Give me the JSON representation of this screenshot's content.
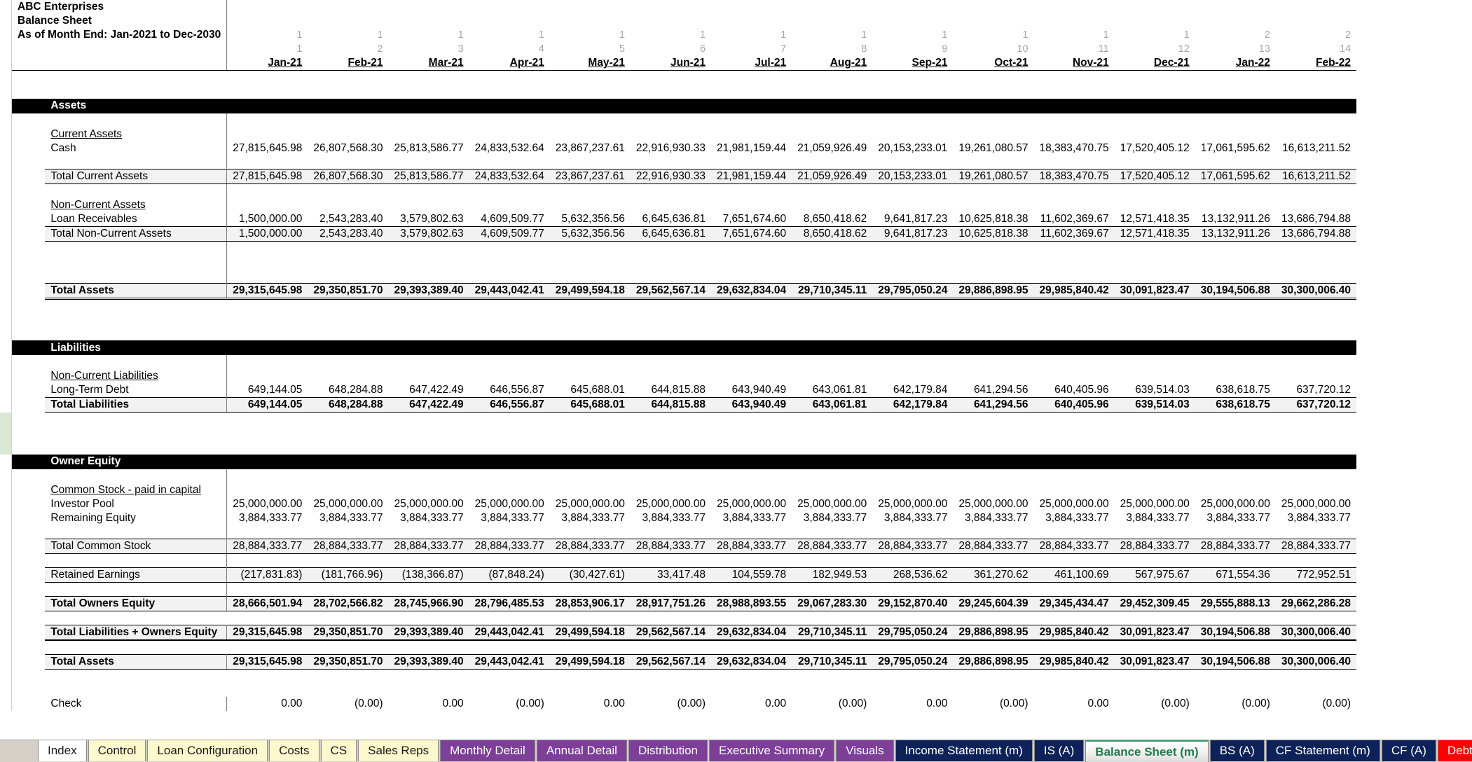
{
  "header": {
    "company": "ABC Enterprises",
    "report": "Balance Sheet",
    "period": "As of Month End: Jan-2021 to Dec-2030"
  },
  "columns": {
    "year_index": [
      "1",
      "1",
      "1",
      "1",
      "1",
      "1",
      "1",
      "1",
      "1",
      "1",
      "1",
      "1",
      "2",
      "2"
    ],
    "month_index": [
      "1",
      "2",
      "3",
      "4",
      "5",
      "6",
      "7",
      "8",
      "9",
      "10",
      "11",
      "12",
      "13",
      "14"
    ],
    "labels": [
      "Jan-21",
      "Feb-21",
      "Mar-21",
      "Apr-21",
      "May-21",
      "Jun-21",
      "Jul-21",
      "Aug-21",
      "Sep-21",
      "Oct-21",
      "Nov-21",
      "Dec-21",
      "Jan-22",
      "Feb-22"
    ]
  },
  "sections": {
    "assets_band": "Assets",
    "liabilities_band": "Liabilities",
    "equity_band": "Owner Equity",
    "current_assets_heading": "Current Assets",
    "non_current_assets_heading": "Non-Current Assets",
    "non_current_liabilities_heading": "Non-Current Liabilities",
    "common_stock_heading": "Common Stock - paid in capital"
  },
  "rows": {
    "cash": {
      "label": "Cash",
      "values": [
        "27,815,645.98",
        "26,807,568.30",
        "25,813,586.77",
        "24,833,532.64",
        "23,867,237.61",
        "22,916,930.33",
        "21,981,159.44",
        "21,059,926.49",
        "20,153,233.01",
        "19,261,080.57",
        "18,383,470.75",
        "17,520,405.12",
        "17,061,595.62",
        "16,613,211.52"
      ]
    },
    "total_current_assets": {
      "label": "Total Current Assets",
      "values": [
        "27,815,645.98",
        "26,807,568.30",
        "25,813,586.77",
        "24,833,532.64",
        "23,867,237.61",
        "22,916,930.33",
        "21,981,159.44",
        "21,059,926.49",
        "20,153,233.01",
        "19,261,080.57",
        "18,383,470.75",
        "17,520,405.12",
        "17,061,595.62",
        "16,613,211.52"
      ]
    },
    "loan_receivables": {
      "label": "Loan Receivables",
      "values": [
        "1,500,000.00",
        "2,543,283.40",
        "3,579,802.63",
        "4,609,509.77",
        "5,632,356.56",
        "6,645,636.81",
        "7,651,674.60",
        "8,650,418.62",
        "9,641,817.23",
        "10,625,818.38",
        "11,602,369.67",
        "12,571,418.35",
        "13,132,911.26",
        "13,686,794.88"
      ]
    },
    "total_non_current_assets": {
      "label": "Total Non-Current Assets",
      "values": [
        "1,500,000.00",
        "2,543,283.40",
        "3,579,802.63",
        "4,609,509.77",
        "5,632,356.56",
        "6,645,636.81",
        "7,651,674.60",
        "8,650,418.62",
        "9,641,817.23",
        "10,625,818.38",
        "11,602,369.67",
        "12,571,418.35",
        "13,132,911.26",
        "13,686,794.88"
      ]
    },
    "total_assets": {
      "label": "Total Assets",
      "values": [
        "29,315,645.98",
        "29,350,851.70",
        "29,393,389.40",
        "29,443,042.41",
        "29,499,594.18",
        "29,562,567.14",
        "29,632,834.04",
        "29,710,345.11",
        "29,795,050.24",
        "29,886,898.95",
        "29,985,840.42",
        "30,091,823.47",
        "30,194,506.88",
        "30,300,006.40"
      ]
    },
    "long_term_debt": {
      "label": "Long-Term Debt",
      "values": [
        "649,144.05",
        "648,284.88",
        "647,422.49",
        "646,556.87",
        "645,688.01",
        "644,815.88",
        "643,940.49",
        "643,061.81",
        "642,179.84",
        "641,294.56",
        "640,405.96",
        "639,514.03",
        "638,618.75",
        "637,720.12"
      ]
    },
    "total_liabilities": {
      "label": "Total Liabilities",
      "values": [
        "649,144.05",
        "648,284.88",
        "647,422.49",
        "646,556.87",
        "645,688.01",
        "644,815.88",
        "643,940.49",
        "643,061.81",
        "642,179.84",
        "641,294.56",
        "640,405.96",
        "639,514.03",
        "638,618.75",
        "637,720.12"
      ]
    },
    "investor_pool": {
      "label": "Investor Pool",
      "values": [
        "25,000,000.00",
        "25,000,000.00",
        "25,000,000.00",
        "25,000,000.00",
        "25,000,000.00",
        "25,000,000.00",
        "25,000,000.00",
        "25,000,000.00",
        "25,000,000.00",
        "25,000,000.00",
        "25,000,000.00",
        "25,000,000.00",
        "25,000,000.00",
        "25,000,000.00"
      ]
    },
    "remaining_equity": {
      "label": "Remaining Equity",
      "values": [
        "3,884,333.77",
        "3,884,333.77",
        "3,884,333.77",
        "3,884,333.77",
        "3,884,333.77",
        "3,884,333.77",
        "3,884,333.77",
        "3,884,333.77",
        "3,884,333.77",
        "3,884,333.77",
        "3,884,333.77",
        "3,884,333.77",
        "3,884,333.77",
        "3,884,333.77"
      ]
    },
    "total_common_stock": {
      "label": "Total Common Stock",
      "values": [
        "28,884,333.77",
        "28,884,333.77",
        "28,884,333.77",
        "28,884,333.77",
        "28,884,333.77",
        "28,884,333.77",
        "28,884,333.77",
        "28,884,333.77",
        "28,884,333.77",
        "28,884,333.77",
        "28,884,333.77",
        "28,884,333.77",
        "28,884,333.77",
        "28,884,333.77"
      ]
    },
    "retained_earnings": {
      "label": "Retained Earnings",
      "values": [
        "(217,831.83)",
        "(181,766.96)",
        "(138,366.87)",
        "(87,848.24)",
        "(30,427.61)",
        "33,417.48",
        "104,559.78",
        "182,949.53",
        "268,536.62",
        "361,270.62",
        "461,100.69",
        "567,975.67",
        "671,554.36",
        "772,952.51"
      ]
    },
    "total_owners_equity": {
      "label": "Total Owners Equity",
      "values": [
        "28,666,501.94",
        "28,702,566.82",
        "28,745,966.90",
        "28,796,485.53",
        "28,853,906.17",
        "28,917,751.26",
        "28,988,893.55",
        "29,067,283.30",
        "29,152,870.40",
        "29,245,604.39",
        "29,345,434.47",
        "29,452,309.45",
        "29,555,888.13",
        "29,662,286.28"
      ]
    },
    "total_liabilities_equity": {
      "label": "Total Liabilities + Owners Equity",
      "values": [
        "29,315,645.98",
        "29,350,851.70",
        "29,393,389.40",
        "29,443,042.41",
        "29,499,594.18",
        "29,562,567.14",
        "29,632,834.04",
        "29,710,345.11",
        "29,795,050.24",
        "29,886,898.95",
        "29,985,840.42",
        "30,091,823.47",
        "30,194,506.88",
        "30,300,006.40"
      ]
    },
    "total_assets_check": {
      "label": "Total Assets",
      "values": [
        "29,315,645.98",
        "29,350,851.70",
        "29,393,389.40",
        "29,443,042.41",
        "29,499,594.18",
        "29,562,567.14",
        "29,632,834.04",
        "29,710,345.11",
        "29,795,050.24",
        "29,886,898.95",
        "29,985,840.42",
        "30,091,823.47",
        "30,194,506.88",
        "30,300,006.40"
      ]
    },
    "check": {
      "label": "Check",
      "values": [
        "0.00",
        "(0.00)",
        "0.00",
        "(0.00)",
        "0.00",
        "(0.00)",
        "0.00",
        "(0.00)",
        "0.00",
        "(0.00)",
        "0.00",
        "(0.00)",
        "(0.00)",
        "(0.00)"
      ]
    }
  },
  "tabs": [
    {
      "label": "Index",
      "style": "white",
      "active": false
    },
    {
      "label": "Control",
      "style": "yellow",
      "active": false
    },
    {
      "label": "Loan Configuration",
      "style": "yellow",
      "active": false
    },
    {
      "label": "Costs",
      "style": "yellow",
      "active": false
    },
    {
      "label": "CS",
      "style": "yellow",
      "active": false
    },
    {
      "label": "Sales Reps",
      "style": "yellow",
      "active": false
    },
    {
      "label": "Monthly Detail",
      "style": "purple",
      "active": false
    },
    {
      "label": "Annual Detail",
      "style": "purple",
      "active": false
    },
    {
      "label": "Distribution",
      "style": "purple",
      "active": false
    },
    {
      "label": "Executive Summary",
      "style": "purple",
      "active": false
    },
    {
      "label": "Visuals",
      "style": "purple",
      "active": false
    },
    {
      "label": "Income Statement (m)",
      "style": "navy",
      "active": false
    },
    {
      "label": "IS (A)",
      "style": "navy",
      "active": false
    },
    {
      "label": "Balance Sheet (m)",
      "style": "active",
      "active": true
    },
    {
      "label": "BS (A)",
      "style": "navy",
      "active": false
    },
    {
      "label": "CF Statement (m)",
      "style": "navy",
      "active": false
    },
    {
      "label": "CF (A)",
      "style": "navy",
      "active": false
    },
    {
      "label": "Debt",
      "style": "red",
      "active": false
    }
  ],
  "colors": {
    "band": "#000000",
    "tab_active_text": "#1f7a4d",
    "tab_yellow": "#fdf8cd",
    "tab_purple": "#7d3f98",
    "tab_navy": "#0d2259",
    "tab_red": "#fe0000",
    "subtotal_fill": "#f2f2f2"
  }
}
